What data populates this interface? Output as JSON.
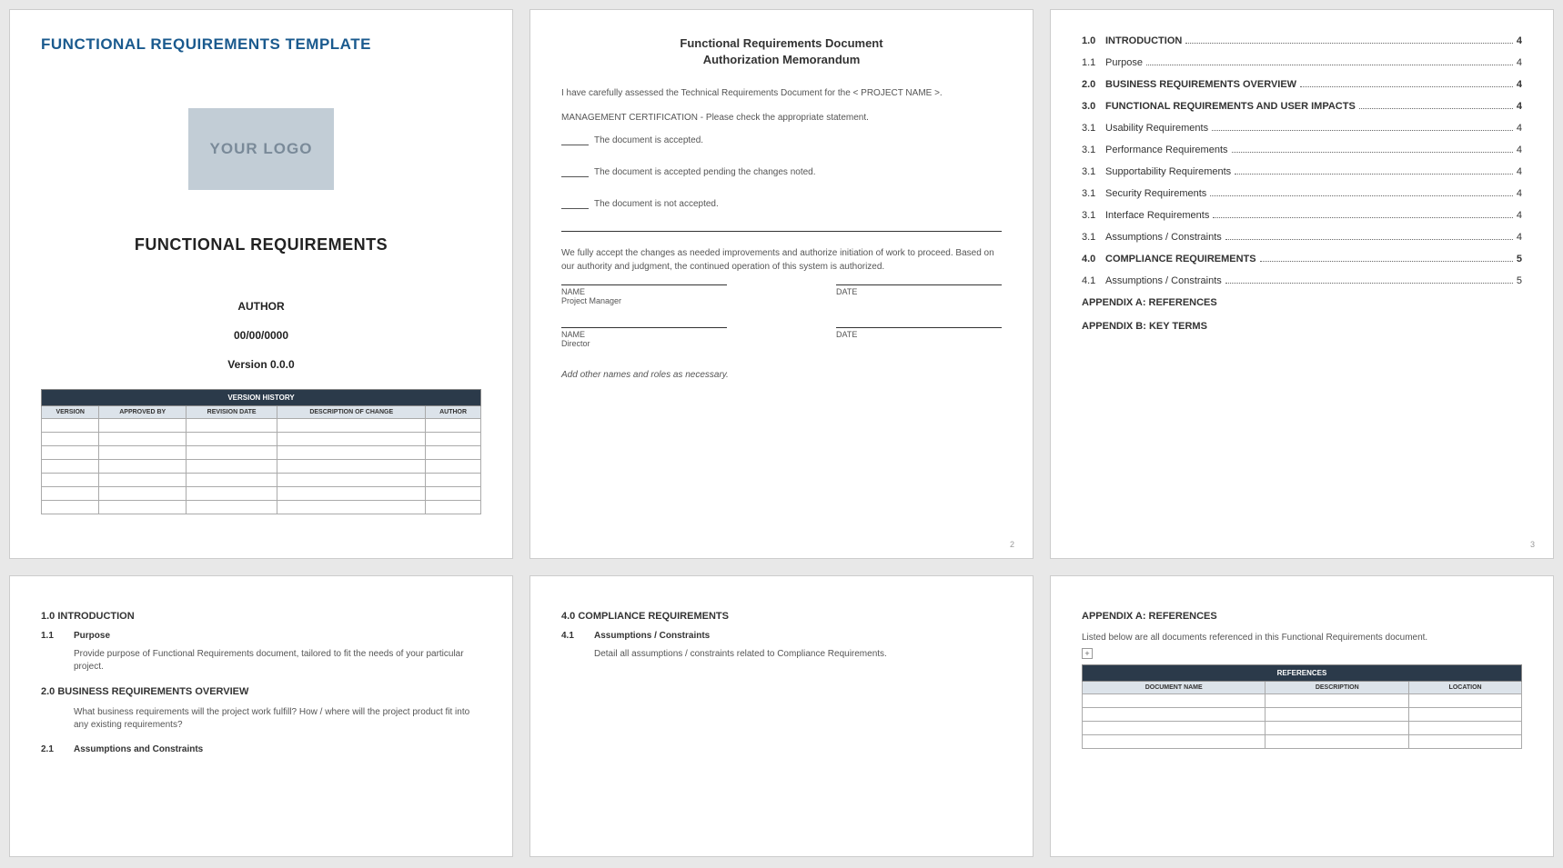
{
  "page1": {
    "templateHeader": "FUNCTIONAL REQUIREMENTS TEMPLATE",
    "logoText": "YOUR LOGO",
    "docTitle": "FUNCTIONAL REQUIREMENTS",
    "author": "AUTHOR",
    "date": "00/00/0000",
    "version": "Version 0.0.0",
    "versionTable": {
      "title": "VERSION HISTORY",
      "headers": [
        "VERSION",
        "APPROVED BY",
        "REVISION DATE",
        "DESCRIPTION OF CHANGE",
        "AUTHOR"
      ]
    }
  },
  "page2": {
    "titleLine1": "Functional Requirements Document",
    "titleLine2": "Authorization Memorandum",
    "intro": "I have carefully assessed the Technical Requirements Document for the < PROJECT NAME >.",
    "mgmtCert": "MANAGEMENT CERTIFICATION - Please check the appropriate statement.",
    "opt1": "The document is accepted.",
    "opt2": "The document is accepted pending the changes noted.",
    "opt3": "The document is not accepted.",
    "acceptText": "We fully accept the changes as needed improvements and authorize initiation of work to proceed. Based on our authority and judgment, the continued operation of this system is authorized.",
    "nameLabel": "NAME",
    "dateLabel": "DATE",
    "role1": "Project Manager",
    "role2": "Director",
    "addNote": "Add other names and roles as necessary.",
    "pageNum": "2"
  },
  "page3": {
    "toc": [
      {
        "num": "1.0",
        "label": "INTRODUCTION",
        "page": "4",
        "bold": true
      },
      {
        "num": "1.1",
        "label": "Purpose",
        "page": "4",
        "bold": false
      },
      {
        "num": "2.0",
        "label": "BUSINESS REQUIREMENTS OVERVIEW",
        "page": "4",
        "bold": true
      },
      {
        "num": "3.0",
        "label": "FUNCTIONAL REQUIREMENTS AND USER IMPACTS",
        "page": "4",
        "bold": true
      },
      {
        "num": "3.1",
        "label": "Usability Requirements",
        "page": "4",
        "bold": false
      },
      {
        "num": "3.1",
        "label": "Performance Requirements",
        "page": "4",
        "bold": false
      },
      {
        "num": "3.1",
        "label": "Supportability Requirements",
        "page": "4",
        "bold": false
      },
      {
        "num": "3.1",
        "label": "Security Requirements",
        "page": "4",
        "bold": false
      },
      {
        "num": "3.1",
        "label": "Interface Requirements",
        "page": "4",
        "bold": false
      },
      {
        "num": "3.1",
        "label": "Assumptions / Constraints",
        "page": "4",
        "bold": false
      },
      {
        "num": "4.0",
        "label": "COMPLIANCE REQUIREMENTS",
        "page": "5",
        "bold": true
      },
      {
        "num": "4.1",
        "label": "Assumptions / Constraints",
        "page": "5",
        "bold": false
      }
    ],
    "appendixA": "APPENDIX A: REFERENCES",
    "appendixB": "APPENDIX B: KEY TERMS",
    "pageNum": "3"
  },
  "page4": {
    "s1": "1.0  INTRODUCTION",
    "s1_1n": "1.1",
    "s1_1l": "Purpose",
    "s1_1t": "Provide purpose of Functional Requirements document, tailored to fit the needs of your particular project.",
    "s2": "2.0  BUSINESS REQUIREMENTS OVERVIEW",
    "s2t": "What business requirements will the project work fulfill?  How / where will the project product fit into any existing requirements?",
    "s2_1n": "2.1",
    "s2_1l": "Assumptions and Constraints"
  },
  "page5": {
    "s4": "4.0  COMPLIANCE REQUIREMENTS",
    "s4_1n": "4.1",
    "s4_1l": "Assumptions / Constraints",
    "s4_1t": "Detail all assumptions / constraints related to Compliance Requirements."
  },
  "page6": {
    "title": "APPENDIX A: REFERENCES",
    "intro": "Listed below are all documents referenced in this Functional Requirements document.",
    "refTable": {
      "title": "REFERENCES",
      "headers": [
        "DOCUMENT NAME",
        "DESCRIPTION",
        "LOCATION"
      ]
    }
  }
}
